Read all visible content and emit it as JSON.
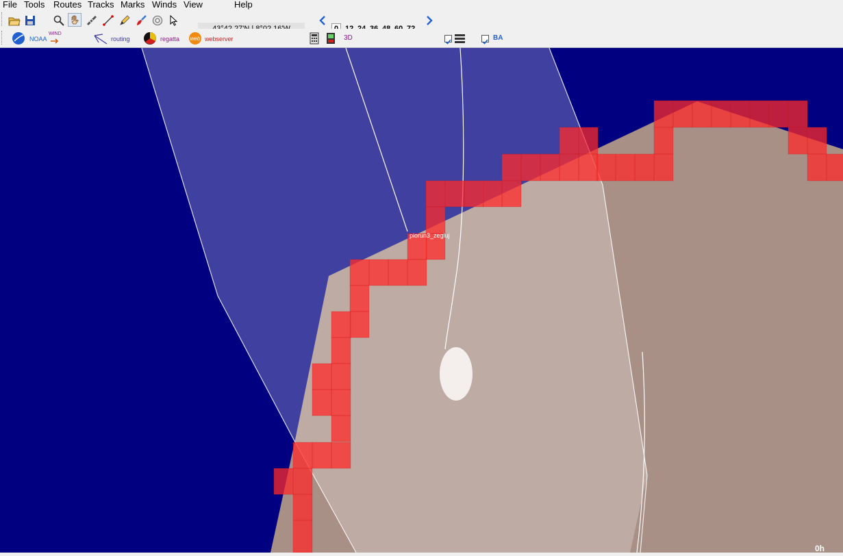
{
  "menu": [
    "File",
    "Tools",
    "Routes",
    "Tracks",
    "Marks",
    "Winds",
    "View",
    "Help"
  ],
  "coordinates": "43°42.27'N |  8°02.16'W",
  "forecast_hours": [
    "0",
    "12",
    "24",
    "36",
    "48",
    "60",
    "72"
  ],
  "toolbar2": {
    "noaa": "NOAA",
    "wind": "WIND",
    "routing": "routing",
    "regatta": "regatta",
    "webserver": "webserver",
    "three_d": "3D",
    "ba": "BA"
  },
  "map": {
    "boat_label": "piorun3_zegluj",
    "time_label": "0h"
  },
  "colors": {
    "sea": "#000080",
    "land": "#a89086",
    "accent": "#1f5fcf"
  }
}
